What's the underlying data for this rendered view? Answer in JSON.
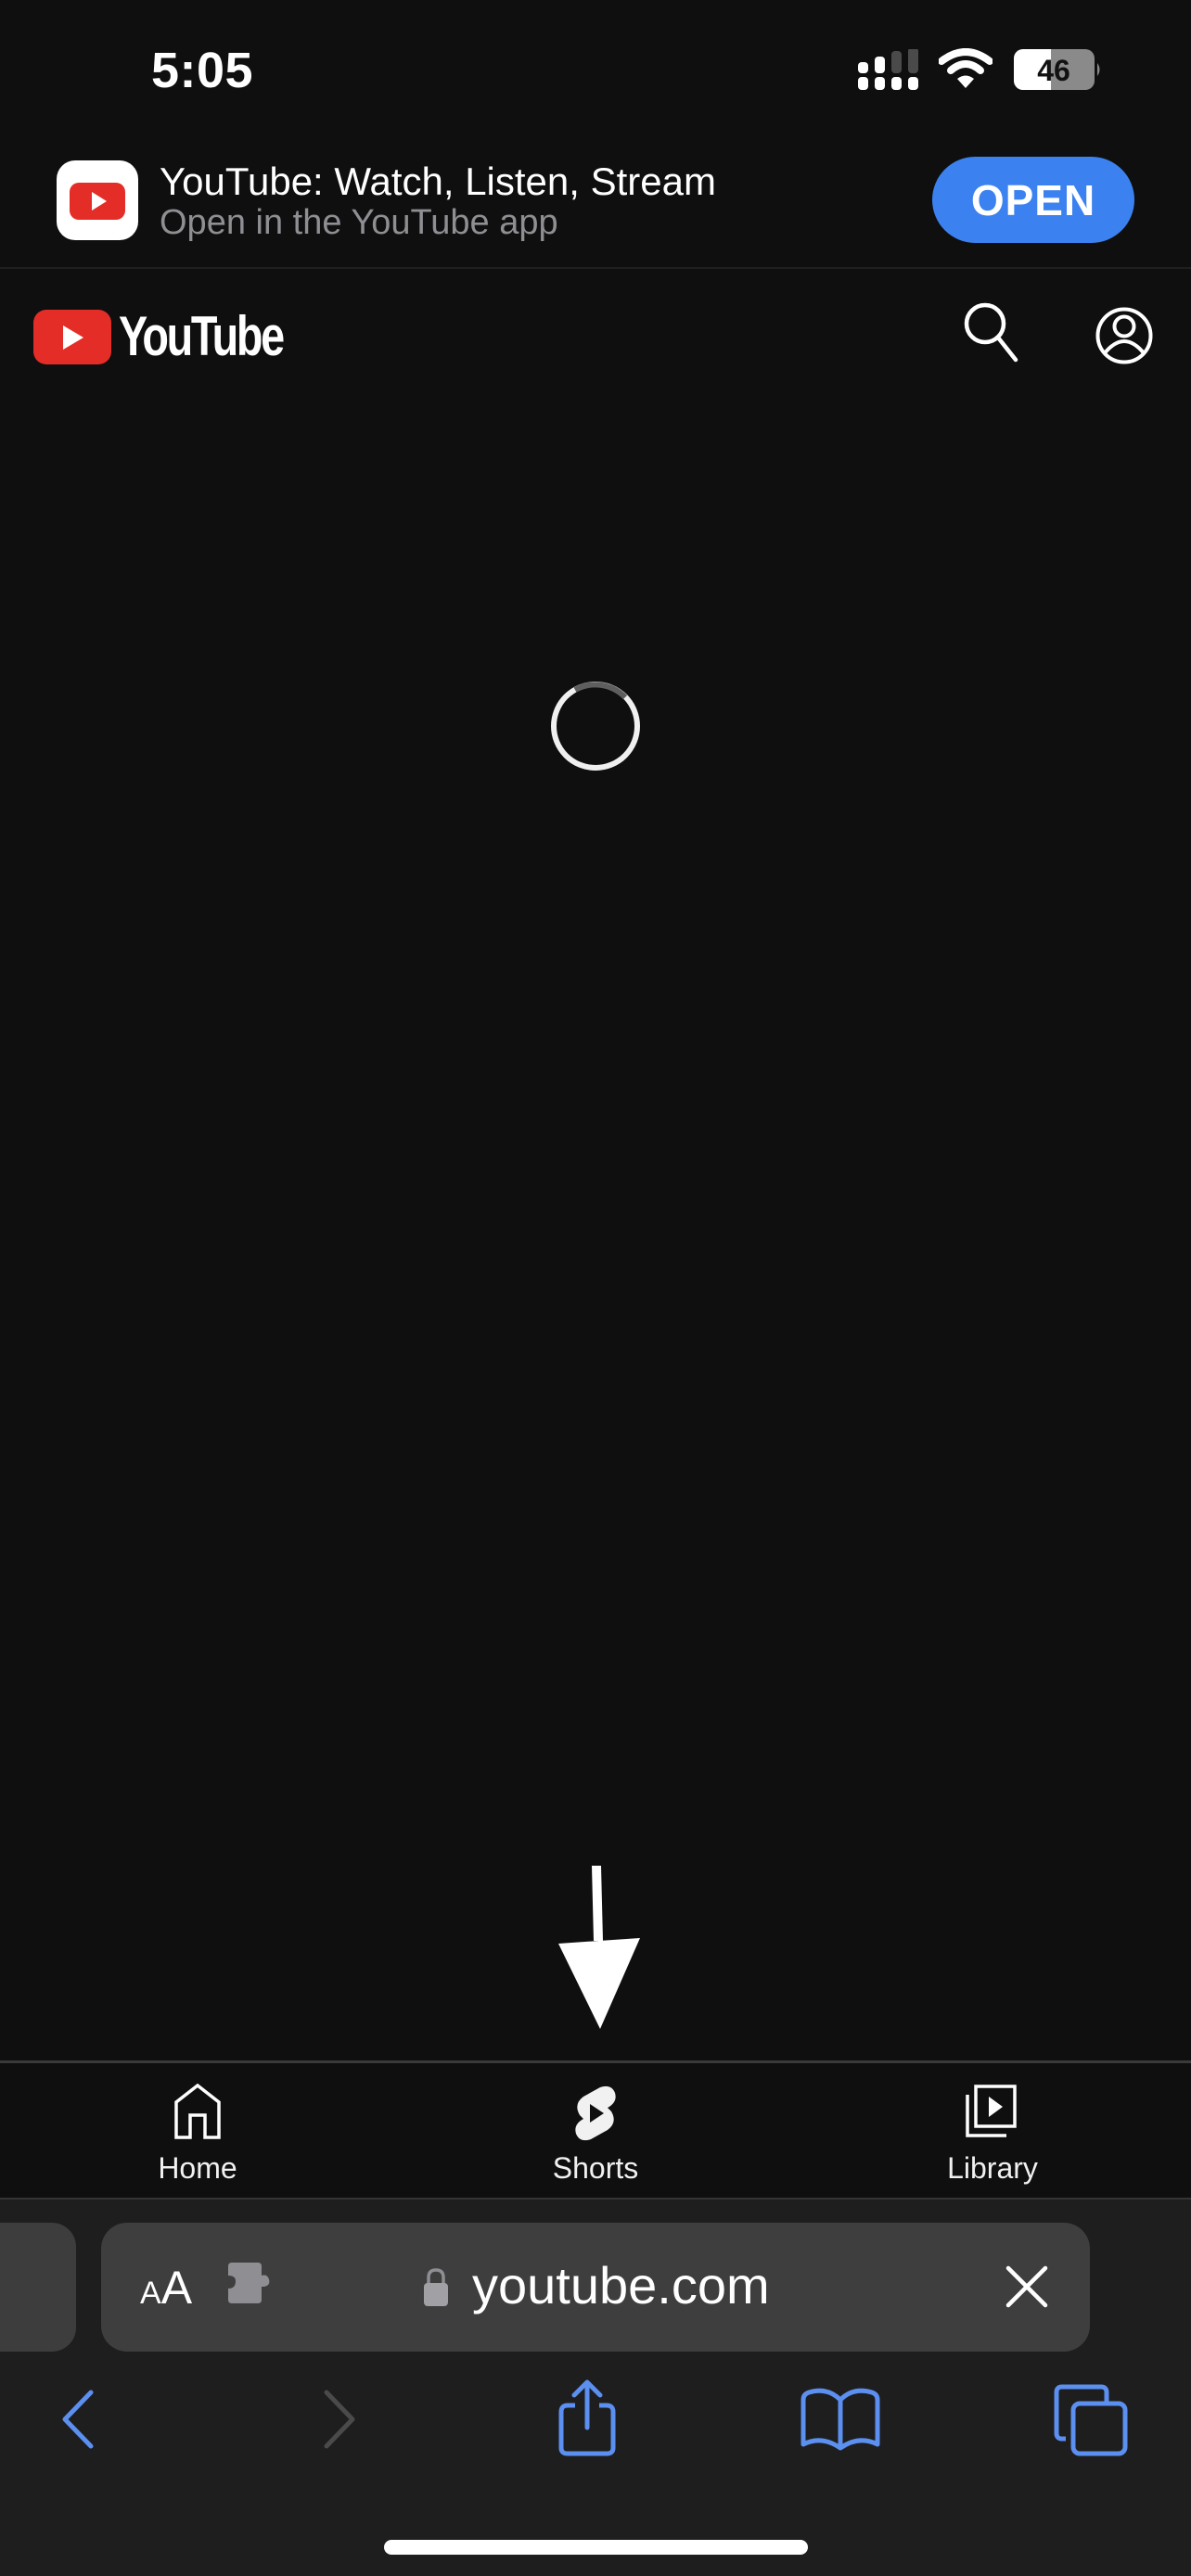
{
  "status_bar": {
    "time": "5:05",
    "battery_percent": 46,
    "battery_label": "46",
    "signal_bars_active": 2,
    "signal_bars_total": 4
  },
  "app_banner": {
    "title": "YouTube: Watch, Listen, Stream",
    "subtitle": "Open in the YouTube app",
    "open_label": "OPEN",
    "app_icon": "youtube-app-icon"
  },
  "yt_header": {
    "logo_text": "YouTube",
    "icons": [
      "search-icon",
      "account-icon"
    ]
  },
  "content": {
    "state": "loading",
    "spinner_icon": "loading-spinner"
  },
  "annotation": {
    "type": "arrow",
    "points_to": "Shorts"
  },
  "yt_nav": {
    "items": [
      {
        "label": "Home",
        "icon": "home-icon"
      },
      {
        "label": "Shorts",
        "icon": "shorts-icon"
      },
      {
        "label": "Library",
        "icon": "library-icon"
      }
    ]
  },
  "safari": {
    "reader_small": "A",
    "reader_big": "A",
    "url": "youtube.com",
    "toolbar": [
      "back-icon",
      "forward-icon",
      "share-icon",
      "bookmarks-icon",
      "tabs-icon"
    ],
    "forward_enabled": false
  },
  "colors": {
    "background": "#0f0f0f",
    "youtube_red": "#e52d27",
    "open_button_blue": "#3b82f0",
    "safari_tint": "#5b8ff0",
    "toolbar_bg": "#1e1e1e",
    "address_pill": "#3e3e3e",
    "subtitle_gray": "#8e8e93"
  }
}
